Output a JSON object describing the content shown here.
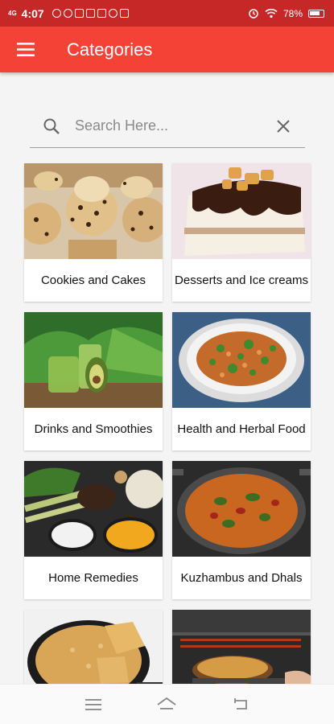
{
  "status_bar": {
    "network": "4G",
    "time": "4:07",
    "battery": "78%"
  },
  "app_bar": {
    "title": "Categories",
    "menu_icon": "hamburger-menu-icon"
  },
  "search": {
    "placeholder": "Search Here...",
    "value": ""
  },
  "categories": [
    {
      "label": "Cookies and Cakes"
    },
    {
      "label": "Desserts and Ice creams"
    },
    {
      "label": "Drinks and Smoothies"
    },
    {
      "label": "Health and Herbal Food"
    },
    {
      "label": "Home Remedies"
    },
    {
      "label": "Kuzhambus and Dhals"
    },
    {
      "label": ""
    },
    {
      "label": ""
    }
  ],
  "colors": {
    "status_bar": "#c62828",
    "app_bar": "#f44336",
    "background": "#f4f4f4"
  }
}
